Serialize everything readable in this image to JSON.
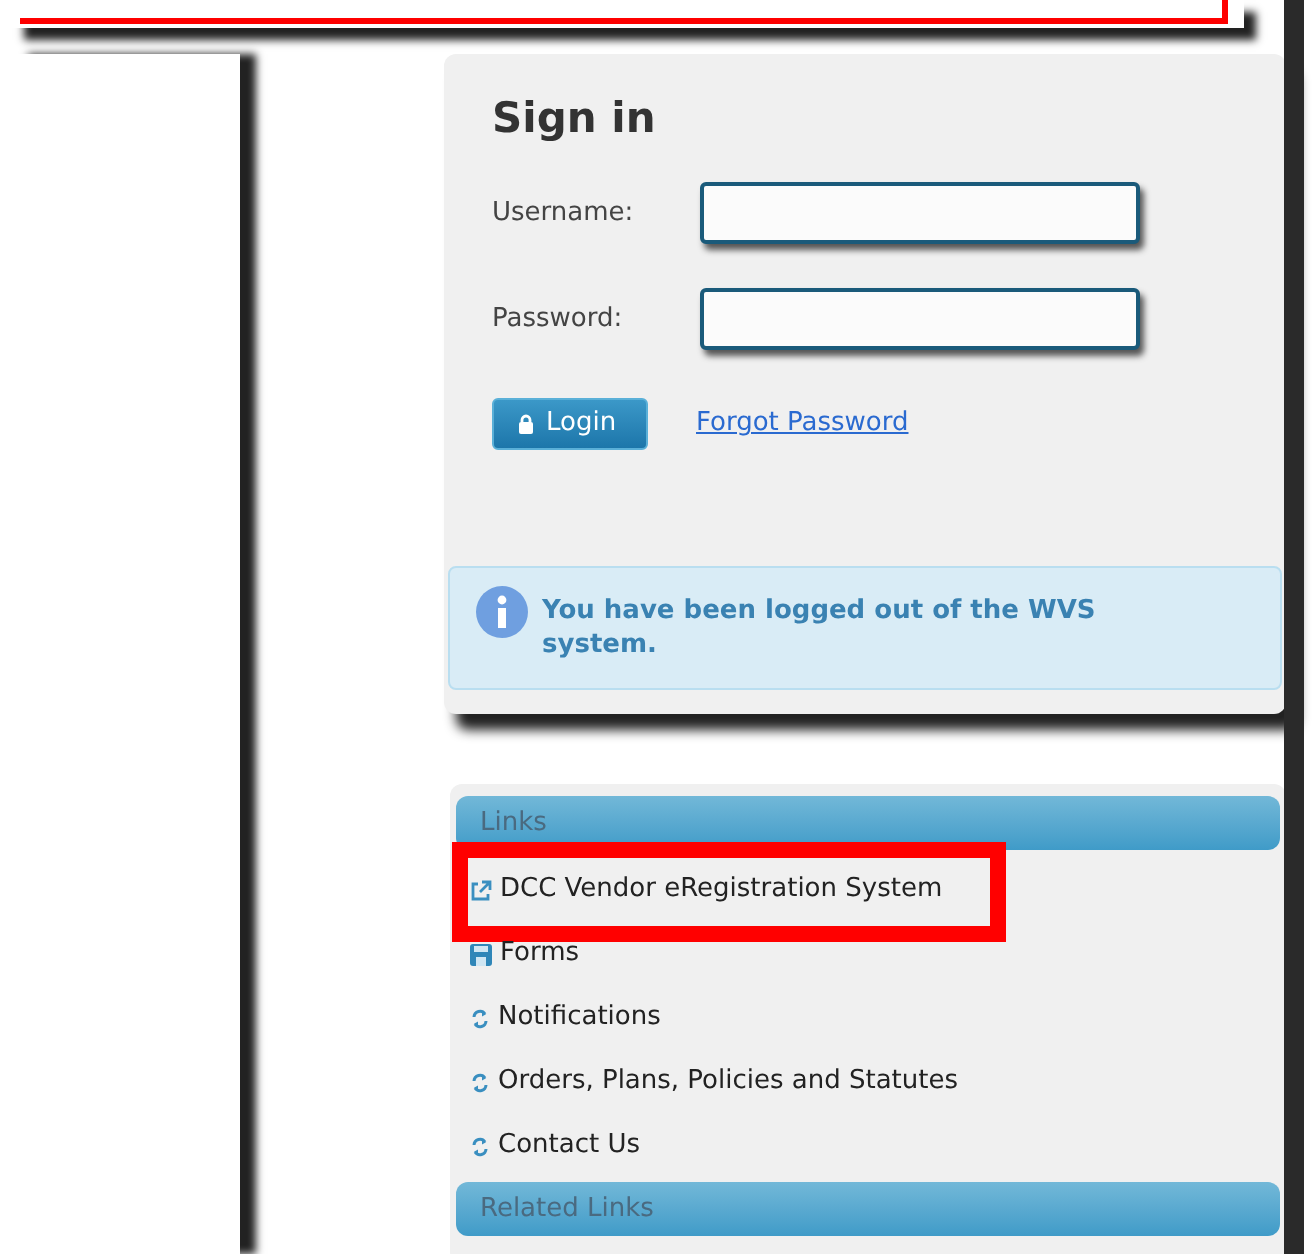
{
  "sign_in": {
    "title": "Sign in",
    "fields": [
      {
        "label": "Username:"
      },
      {
        "label": "Password:"
      }
    ],
    "login_button": "Login",
    "forgot_link": "Forgot Password",
    "message": "You have been logged out of the WVS system."
  },
  "links": {
    "title": "Links",
    "items": [
      {
        "label": "DCC Vendor eRegistration System",
        "kind": "external",
        "highlighted": true
      },
      {
        "label": "Forms",
        "kind": "form",
        "highlighted": false
      },
      {
        "label": "Notifications",
        "kind": "page",
        "highlighted": false
      },
      {
        "label": "Orders, Plans, Policies and Statutes",
        "kind": "page",
        "highlighted": false
      },
      {
        "label": "Contact Us",
        "kind": "page",
        "highlighted": false
      }
    ]
  },
  "related_links": {
    "title": "Related Links"
  }
}
